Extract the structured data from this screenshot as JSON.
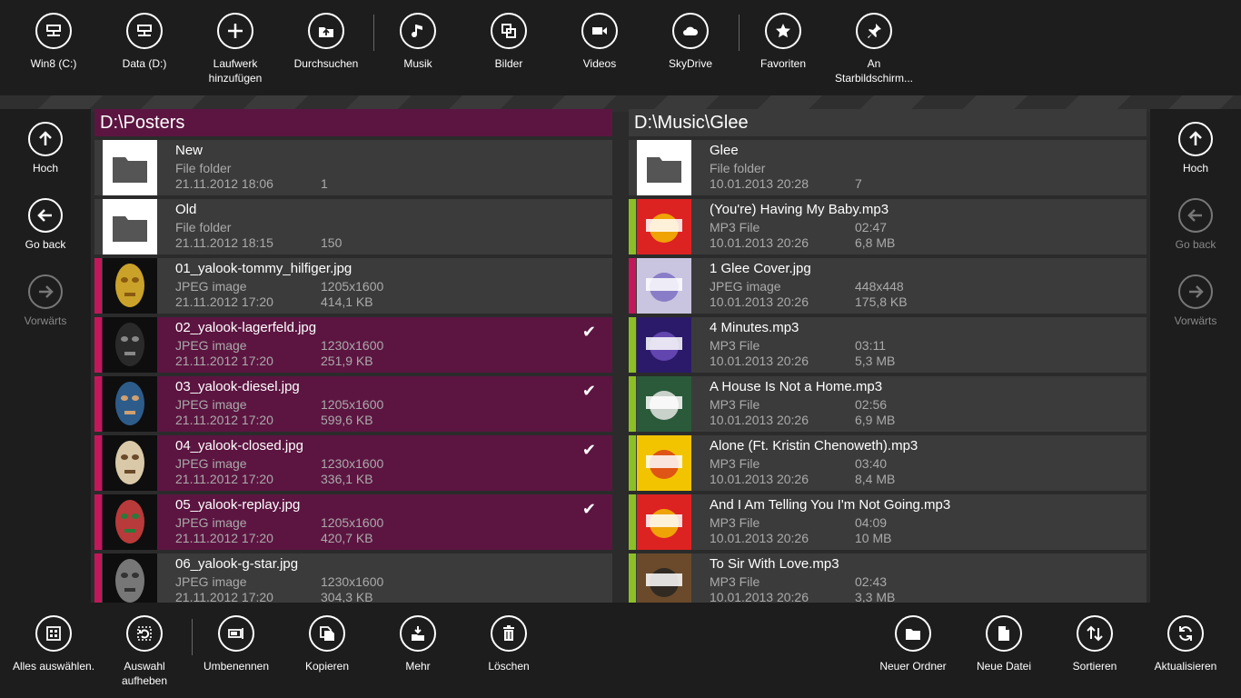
{
  "colors": {
    "selection": "#5c1541",
    "accent_magenta": "#c2185b",
    "accent_green": "#8cbf26",
    "bar_bg": "#1d1d1d"
  },
  "topbar": {
    "items": [
      {
        "label": "Win8 (C:)",
        "icon": "drive-icon"
      },
      {
        "label": "Data (D:)",
        "icon": "drive-icon"
      },
      {
        "label": "Laufwerk\nhinzufügen",
        "icon": "plus-icon"
      },
      {
        "label": "Durchsuchen",
        "icon": "folder-upload-icon"
      },
      {
        "label": "Musik",
        "icon": "music-icon"
      },
      {
        "label": "Bilder",
        "icon": "pictures-icon"
      },
      {
        "label": "Videos",
        "icon": "video-icon"
      },
      {
        "label": "SkyDrive",
        "icon": "cloud-icon"
      },
      {
        "label": "Favoriten",
        "icon": "star-icon"
      },
      {
        "label": "An\nStarbildschirm...",
        "icon": "pin-icon"
      }
    ]
  },
  "left_nav": {
    "up": "Hoch",
    "back": "Go back",
    "forward": "Vorwärts"
  },
  "right_nav": {
    "up": "Hoch",
    "back": "Go back",
    "forward": "Vorwärts"
  },
  "left_pane": {
    "path": "D:\\Posters",
    "rows": [
      {
        "name": "New",
        "type": "File folder",
        "date": "21.11.2012 18:06",
        "meta1": "",
        "meta2": "1",
        "selected": false,
        "folder": true
      },
      {
        "name": "Old",
        "type": "File folder",
        "date": "21.11.2012 18:15",
        "meta1": "",
        "meta2": "150",
        "selected": false,
        "folder": true
      },
      {
        "name": "01_yalook-tommy_hilfiger.jpg",
        "type": "JPEG image",
        "date": "21.11.2012 17:20",
        "meta1": "1205x1600",
        "meta2": "414,1 KB",
        "selected": false,
        "folder": false
      },
      {
        "name": "02_yalook-lagerfeld.jpg",
        "type": "JPEG image",
        "date": "21.11.2012 17:20",
        "meta1": "1230x1600",
        "meta2": "251,9 KB",
        "selected": true,
        "folder": false
      },
      {
        "name": "03_yalook-diesel.jpg",
        "type": "JPEG image",
        "date": "21.11.2012 17:20",
        "meta1": "1205x1600",
        "meta2": "599,6 KB",
        "selected": true,
        "folder": false
      },
      {
        "name": "04_yalook-closed.jpg",
        "type": "JPEG image",
        "date": "21.11.2012 17:20",
        "meta1": "1230x1600",
        "meta2": "336,1 KB",
        "selected": true,
        "folder": false
      },
      {
        "name": "05_yalook-replay.jpg",
        "type": "JPEG image",
        "date": "21.11.2012 17:20",
        "meta1": "1205x1600",
        "meta2": "420,7 KB",
        "selected": true,
        "folder": false
      },
      {
        "name": "06_yalook-g-star.jpg",
        "type": "JPEG image",
        "date": "21.11.2012 17:20",
        "meta1": "1230x1600",
        "meta2": "304,3 KB",
        "selected": false,
        "folder": false
      }
    ]
  },
  "right_pane": {
    "path": "D:\\Music\\Glee",
    "rows": [
      {
        "name": "Glee",
        "type": "File folder",
        "date": "10.01.2013 20:28",
        "meta1": "",
        "meta2": "7",
        "folder": true,
        "accent": ""
      },
      {
        "name": "(You're) Having My Baby.mp3",
        "type": "MP3 File",
        "date": "10.01.2013 20:26",
        "meta1": "02:47",
        "meta2": "6,8 MB",
        "folder": false,
        "accent": "green"
      },
      {
        "name": "1 Glee Cover.jpg",
        "type": "JPEG image",
        "date": "10.01.2013 20:26",
        "meta1": "448x448",
        "meta2": "175,8 KB",
        "folder": false,
        "accent": "magenta"
      },
      {
        "name": "4 Minutes.mp3",
        "type": "MP3 File",
        "date": "10.01.2013 20:26",
        "meta1": "03:11",
        "meta2": "5,3 MB",
        "folder": false,
        "accent": "green"
      },
      {
        "name": "A House Is Not a Home.mp3",
        "type": "MP3 File",
        "date": "10.01.2013 20:26",
        "meta1": "02:56",
        "meta2": "6,9 MB",
        "folder": false,
        "accent": "green"
      },
      {
        "name": "Alone (Ft. Kristin Chenoweth).mp3",
        "type": "MP3 File",
        "date": "10.01.2013 20:26",
        "meta1": "03:40",
        "meta2": "8,4 MB",
        "folder": false,
        "accent": "green"
      },
      {
        "name": "And I Am Telling You I'm Not Going.mp3",
        "type": "MP3 File",
        "date": "10.01.2013 20:26",
        "meta1": "04:09",
        "meta2": "10 MB",
        "folder": false,
        "accent": "green"
      },
      {
        "name": "To Sir With Love.mp3",
        "type": "MP3 File",
        "date": "10.01.2013 20:26",
        "meta1": "02:43",
        "meta2": "3,3 MB",
        "folder": false,
        "accent": "green"
      }
    ]
  },
  "bottombar": {
    "items": [
      {
        "label": "Alles auswählen.",
        "icon": "select-all-icon"
      },
      {
        "label": "Auswahl\naufheben",
        "icon": "clear-selection-icon"
      },
      {
        "label": "Umbenennen",
        "icon": "rename-icon"
      },
      {
        "label": "Kopieren",
        "icon": "copy-icon"
      },
      {
        "label": "Mehr",
        "icon": "more-icon"
      },
      {
        "label": "Löschen",
        "icon": "delete-icon"
      },
      {
        "label": "Neuer Ordner",
        "icon": "new-folder-icon"
      },
      {
        "label": "Neue Datei",
        "icon": "new-file-icon"
      },
      {
        "label": "Sortieren",
        "icon": "sort-icon"
      },
      {
        "label": "Aktualisieren",
        "icon": "refresh-icon"
      }
    ]
  }
}
